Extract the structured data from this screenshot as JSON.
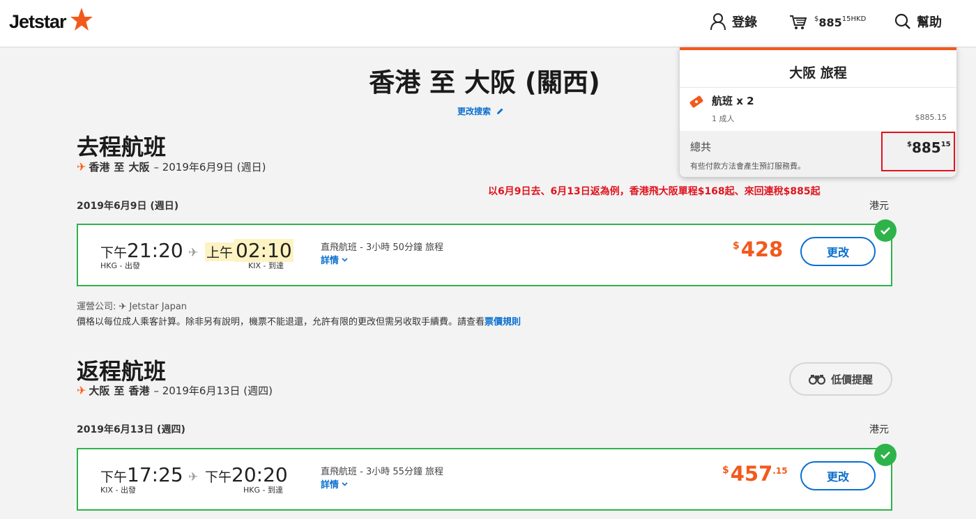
{
  "header": {
    "logo_text": "Jetstar",
    "login_label": "登錄",
    "cart_currency_symbol": "$",
    "cart_amount": "885",
    "cart_cents": "15",
    "cart_currency": "HKD",
    "help_label": "幫助"
  },
  "page": {
    "title": "香港 至 大阪 (關西)",
    "edit_search": "更改搜索"
  },
  "outbound": {
    "heading": "去程航班",
    "route_from": "香港",
    "route_to_word": "至",
    "route_to": "大阪",
    "route_date": "– 2019年6月9日 (週日)",
    "date_row": "2019年6月9日 (週日)",
    "currency": "港元",
    "flight": {
      "dep_prefix": "下午",
      "dep_time": "21:20",
      "dep_airport": "HKG - 出發",
      "arr_prefix": "上午",
      "arr_time": "02:10",
      "arr_airport": "KIX - 到達",
      "info": "直飛航班 - 3小時 50分鐘 旅程",
      "details": "詳情",
      "price_symbol": "$",
      "price": "428",
      "price_cents": "",
      "change": "更改"
    },
    "operator": "運營公司: ✈ Jetstar Japan",
    "fare_note": "價格以每位成人乘客計算。除非另有說明，機票不能退還，允許有限的更改但需另收取手續費。請查看",
    "fare_rules": "票價規則"
  },
  "annotation": {
    "text": "以6月9日去、6月13日返為例，香港飛大阪單程$168起、來回連稅$885起",
    "color": "#e0141e"
  },
  "return": {
    "heading": "返程航班",
    "route_from": "大阪",
    "route_to_word": "至",
    "route_to": "香港",
    "route_date": "– 2019年6月13日 (週四)",
    "price_alert": "低價提醒",
    "date_row": "2019年6月13日 (週四)",
    "currency": "港元",
    "flight": {
      "dep_prefix": "下午",
      "dep_time": "17:25",
      "dep_airport": "KIX - 出發",
      "arr_prefix": "下午",
      "arr_time": "20:20",
      "arr_airport": "HKG - 到達",
      "info": "直飛航班 - 3小時 55分鐘 旅程",
      "details": "詳情",
      "price_symbol": "$",
      "price": "457",
      "price_cents": ".15",
      "change": "更改"
    }
  },
  "cart_dropdown": {
    "title": "大阪 旅程",
    "flights_label": "航班 x 2",
    "passengers": "1 成人",
    "passengers_price": "$885.15",
    "total_label": "總共",
    "total_symbol": "$",
    "total_amount": "885",
    "total_cents": "15",
    "fee_note": "有些付款方法會產生預訂服務費。"
  },
  "colors": {
    "brand_orange": "#f15a1c",
    "link_blue": "#0a6fcf",
    "selected_green": "#2db34a"
  }
}
